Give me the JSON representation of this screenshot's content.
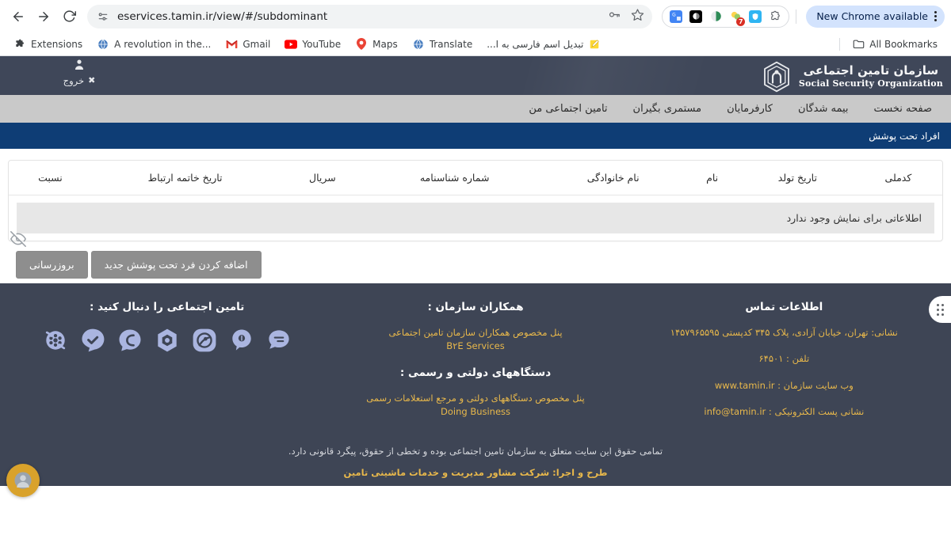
{
  "browser": {
    "back_tooltip": "Back",
    "forward_tooltip": "Forward",
    "reload_tooltip": "Reload",
    "url": "eservices.tamin.ir/view/#/subdominant",
    "site_info_icon": "page-info-icon",
    "password_icon": "key-icon",
    "bookmark_icon": "star-icon",
    "new_chrome_label": "New Chrome available",
    "extensions": [
      {
        "name": "google-translate-extension",
        "badge": ""
      },
      {
        "name": "dark-reader-extension",
        "badge": ""
      },
      {
        "name": "ghostery-extension",
        "badge": ""
      },
      {
        "name": "honey-extension",
        "badge": "7"
      },
      {
        "name": "bitwarden-extension",
        "badge": ""
      },
      {
        "name": "extensions-puzzle-icon",
        "badge": ""
      }
    ],
    "bookmarks": [
      {
        "label": "Extensions",
        "icon": "puzzle-icon"
      },
      {
        "label": "A revolution in the...",
        "icon": "globe-icon"
      },
      {
        "label": "Gmail",
        "icon": "gmail-icon"
      },
      {
        "label": "YouTube",
        "icon": "youtube-icon"
      },
      {
        "label": "Maps",
        "icon": "maps-pin-icon"
      },
      {
        "label": "Translate",
        "icon": "globe-icon"
      },
      {
        "label": "تبدیل اسم فارسی به ا...",
        "icon": "notepad-icon"
      }
    ],
    "all_bookmarks_label": "All Bookmarks",
    "all_bookmarks_icon": "folder-icon"
  },
  "site": {
    "logo": {
      "fa": "سازمان تامین اجتماعی",
      "en": "Social Security Organization",
      "mark": "sso-logo-icon"
    },
    "user": {
      "avatar_icon": "user-icon",
      "logout_label": "خروج",
      "logout_icon": "close-x-icon"
    },
    "nav": [
      {
        "label": "صفحه نخست",
        "name": "nav-home"
      },
      {
        "label": "بیمه شدگان",
        "name": "nav-insured"
      },
      {
        "label": "کارفرمایان",
        "name": "nav-employers"
      },
      {
        "label": "مستمری بگیران",
        "name": "nav-pensioners"
      },
      {
        "label": "تامین اجتماعی من",
        "name": "nav-my-social-security"
      }
    ],
    "subbar_title": "افراد تحت پوشش"
  },
  "table": {
    "headers": [
      "کدملی",
      "تاریخ تولد",
      "نام",
      "نام خانوادگی",
      "شماره شناسنامه",
      "سریال",
      "تاریخ خاتمه ارتباط",
      "نسبت"
    ],
    "empty_message": "اطلاعاتی برای نمایش وجود ندارد",
    "rows": []
  },
  "actions": {
    "add_label": "اضافه کردن فرد تحت پوشش جدید",
    "refresh_label": "بروزرسانی"
  },
  "overlay": {
    "hide_icon": "eye-slash-icon",
    "drag_handle_icon": "six-dots-icon",
    "accessibility_icon": "accessibility-headset-icon"
  },
  "footer": {
    "contact": {
      "title": "اطلاعات تماس",
      "address": "نشانی: تهران، خیابان آزادی، پلاک ۳۴۵ کدپستی ۱۴۵۷۹۶۵۵۹۵",
      "phone": "تلفن : ۶۴۵۰۱",
      "website": "وب سایت سازمان : www.tamin.ir",
      "email": "نشانی پست الکترونیکی : info@tamin.ir"
    },
    "partners": {
      "title": "همکاران سازمان :",
      "link1_fa": "پنل مخصوص همکاران سازمان تامین اجتماعی",
      "link1_en": "B۲E Services",
      "title2": "دستگاههای دولتی و رسمی :",
      "link2_fa": "پنل مخصوص دستگاههای دولتی و مرجع استعلامات رسمی",
      "link2_en": "Doing Business"
    },
    "social": {
      "title": "تامین اجتماعی را دنبال کنید :",
      "icons": [
        "aparat-icon",
        "bale-icon",
        "soroush-icon",
        "rubika-icon",
        "eitaa-icon",
        "igap-icon",
        "gap-icon"
      ]
    },
    "copyright": "تمامی حقوق این سایت متعلق به سازمان تامین اجتماعی بوده و تخطی از حقوق، پیگرد قانونی دارد.",
    "credit_prefix": "طرح و اجرا: ",
    "credit": "طرح و اجرا: شرکت مشاور مدیریت و خدمات ماشینی تامین"
  },
  "colors": {
    "header_bg": "#3f4759",
    "nav_bg": "#c9c9c9",
    "subbar_bg": "#0e3d75",
    "footer_bg": "#3e4555",
    "accent_gold": "#e8b84b",
    "button_gray": "#8e8e8e"
  }
}
